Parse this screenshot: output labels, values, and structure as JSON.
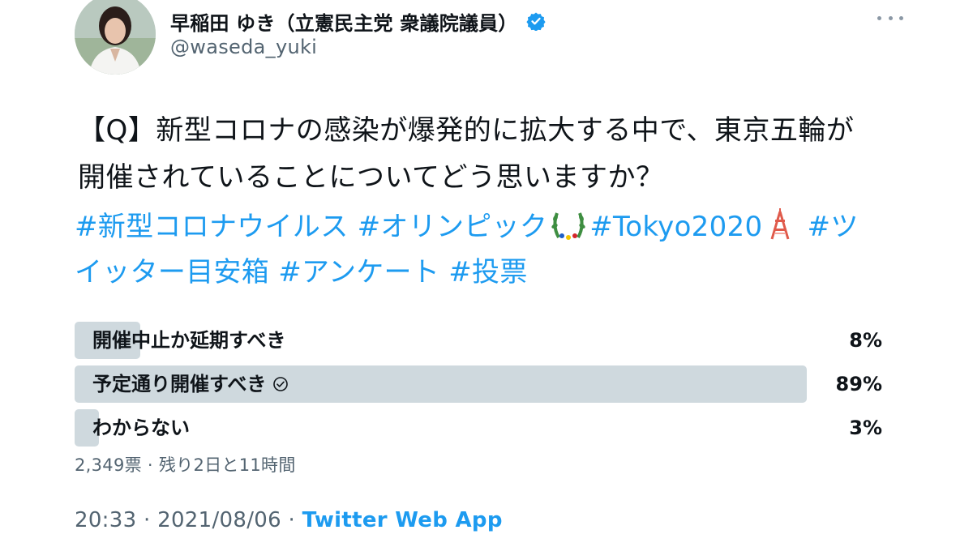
{
  "author": {
    "display_name": "早稲田 ゆき（立憲民主党 衆議院議員）",
    "handle": "@waseda_yuki",
    "verified": true,
    "avatar_icon": "profile-photo"
  },
  "more_menu_icon": "more-horizontal-icon",
  "tweet": {
    "question_line1": "【Q】新型コロナの感染が爆発的に拡大する中で、東京五輪が",
    "question_line2": "開催されていることについてどう思いますか？",
    "hashtags": {
      "tag1": "#新型コロナウイルス",
      "tag2": "#オリンピック",
      "tag3": "#Tokyo2020",
      "tag4a": "#ツ",
      "tag4b": "イッター目安箱",
      "tag5": "#アンケート",
      "tag6": "#投票"
    },
    "emojis": [
      "olympic-wreath",
      "tokyo-tower"
    ]
  },
  "poll": {
    "options": [
      {
        "label": "開催中止か延期すべき",
        "percent_text": "8%",
        "percent": 8,
        "voted": false
      },
      {
        "label": "予定通り開催すべき",
        "percent_text": "89%",
        "percent": 89,
        "voted": true
      },
      {
        "label": "わからない",
        "percent_text": "3%",
        "percent": 3,
        "voted": false
      }
    ],
    "meta": "2,349票 · 残り2日と11時間"
  },
  "footer": {
    "timestamp": "20:33 · 2021/08/06 · ",
    "source": "Twitter Web App"
  },
  "colors": {
    "link": "#1d9bf0",
    "secondary_text": "#536471",
    "poll_bar": "#cfd9de",
    "text": "#0f1419"
  }
}
